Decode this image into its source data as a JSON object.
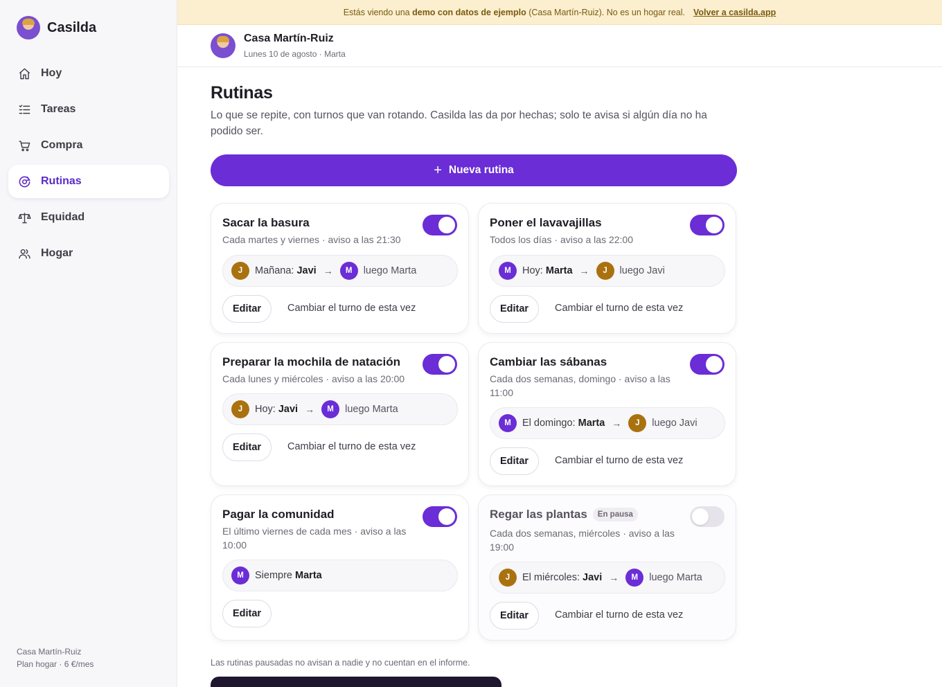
{
  "sidebar": {
    "brand": "Casilda",
    "items": [
      {
        "label": "Hoy",
        "icon": "home-icon"
      },
      {
        "label": "Tareas",
        "icon": "list-icon"
      },
      {
        "label": "Compra",
        "icon": "cart-icon"
      },
      {
        "label": "Rutinas",
        "icon": "routine-icon",
        "active": true
      },
      {
        "label": "Equidad",
        "icon": "scale-icon"
      },
      {
        "label": "Hogar",
        "icon": "people-icon"
      }
    ],
    "footer_household": "Casa Martín-Ruiz",
    "footer_plan": "Plan hogar · 6 €/mes"
  },
  "banner": {
    "prefix": "Estás viendo una",
    "bold": "demo con datos de ejemplo",
    "suffix": "(Casa Martín-Ruiz). No es un hogar real.",
    "link": "Volver a casilda.app"
  },
  "header": {
    "title": "Casa Martín-Ruiz",
    "subtitle": "Lunes 10 de agosto · Marta"
  },
  "main": {
    "title": "Rutinas",
    "description": "Lo que se repite, con turnos que van rotando. Casilda las da por hechas; solo te avisa si algún día no ha podido ser.",
    "new_button": "Nueva rutina",
    "edit_label": "Editar",
    "swap_label": "Cambiar el turno de esta vez",
    "footnote": "Las rutinas pausadas no avisan a nadie y no cuentan en el informe."
  },
  "routines": [
    {
      "title": "Sacar la basura",
      "schedule": "Cada martes y viernes · aviso a las 21:30",
      "enabled": true,
      "now_initial": "J",
      "now_label": "Mañana:",
      "now_name": "Javi",
      "next_initial": "M",
      "next_label": "luego Marta"
    },
    {
      "title": "Poner el lavavajillas",
      "schedule": "Todos los días · aviso a las 22:00",
      "enabled": true,
      "now_initial": "M",
      "now_label": "Hoy:",
      "now_name": "Marta",
      "next_initial": "J",
      "next_label": "luego Javi"
    },
    {
      "title": "Preparar la mochila de natación",
      "schedule": "Cada lunes y miércoles · aviso a las 20:00",
      "enabled": true,
      "now_initial": "J",
      "now_label": "Hoy:",
      "now_name": "Javi",
      "next_initial": "M",
      "next_label": "luego Marta"
    },
    {
      "title": "Cambiar las sábanas",
      "schedule": "Cada dos semanas, domingo · aviso a las 11:00",
      "enabled": true,
      "now_initial": "M",
      "now_label": "El domingo:",
      "now_name": "Marta",
      "next_initial": "J",
      "next_label": "luego Javi"
    },
    {
      "title": "Pagar la comunidad",
      "schedule": "El último viernes de cada mes · aviso a las 10:00",
      "enabled": true,
      "now_initial": "M",
      "now_label": "Siempre",
      "now_name": "Marta"
    },
    {
      "title": "Regar las plantas",
      "paused_badge": "En pausa",
      "schedule": "Cada dos semanas, miércoles · aviso a las 19:00",
      "enabled": false,
      "now_initial": "J",
      "now_label": "El miércoles:",
      "now_name": "Javi",
      "next_initial": "M",
      "next_label": "luego Marta"
    }
  ]
}
